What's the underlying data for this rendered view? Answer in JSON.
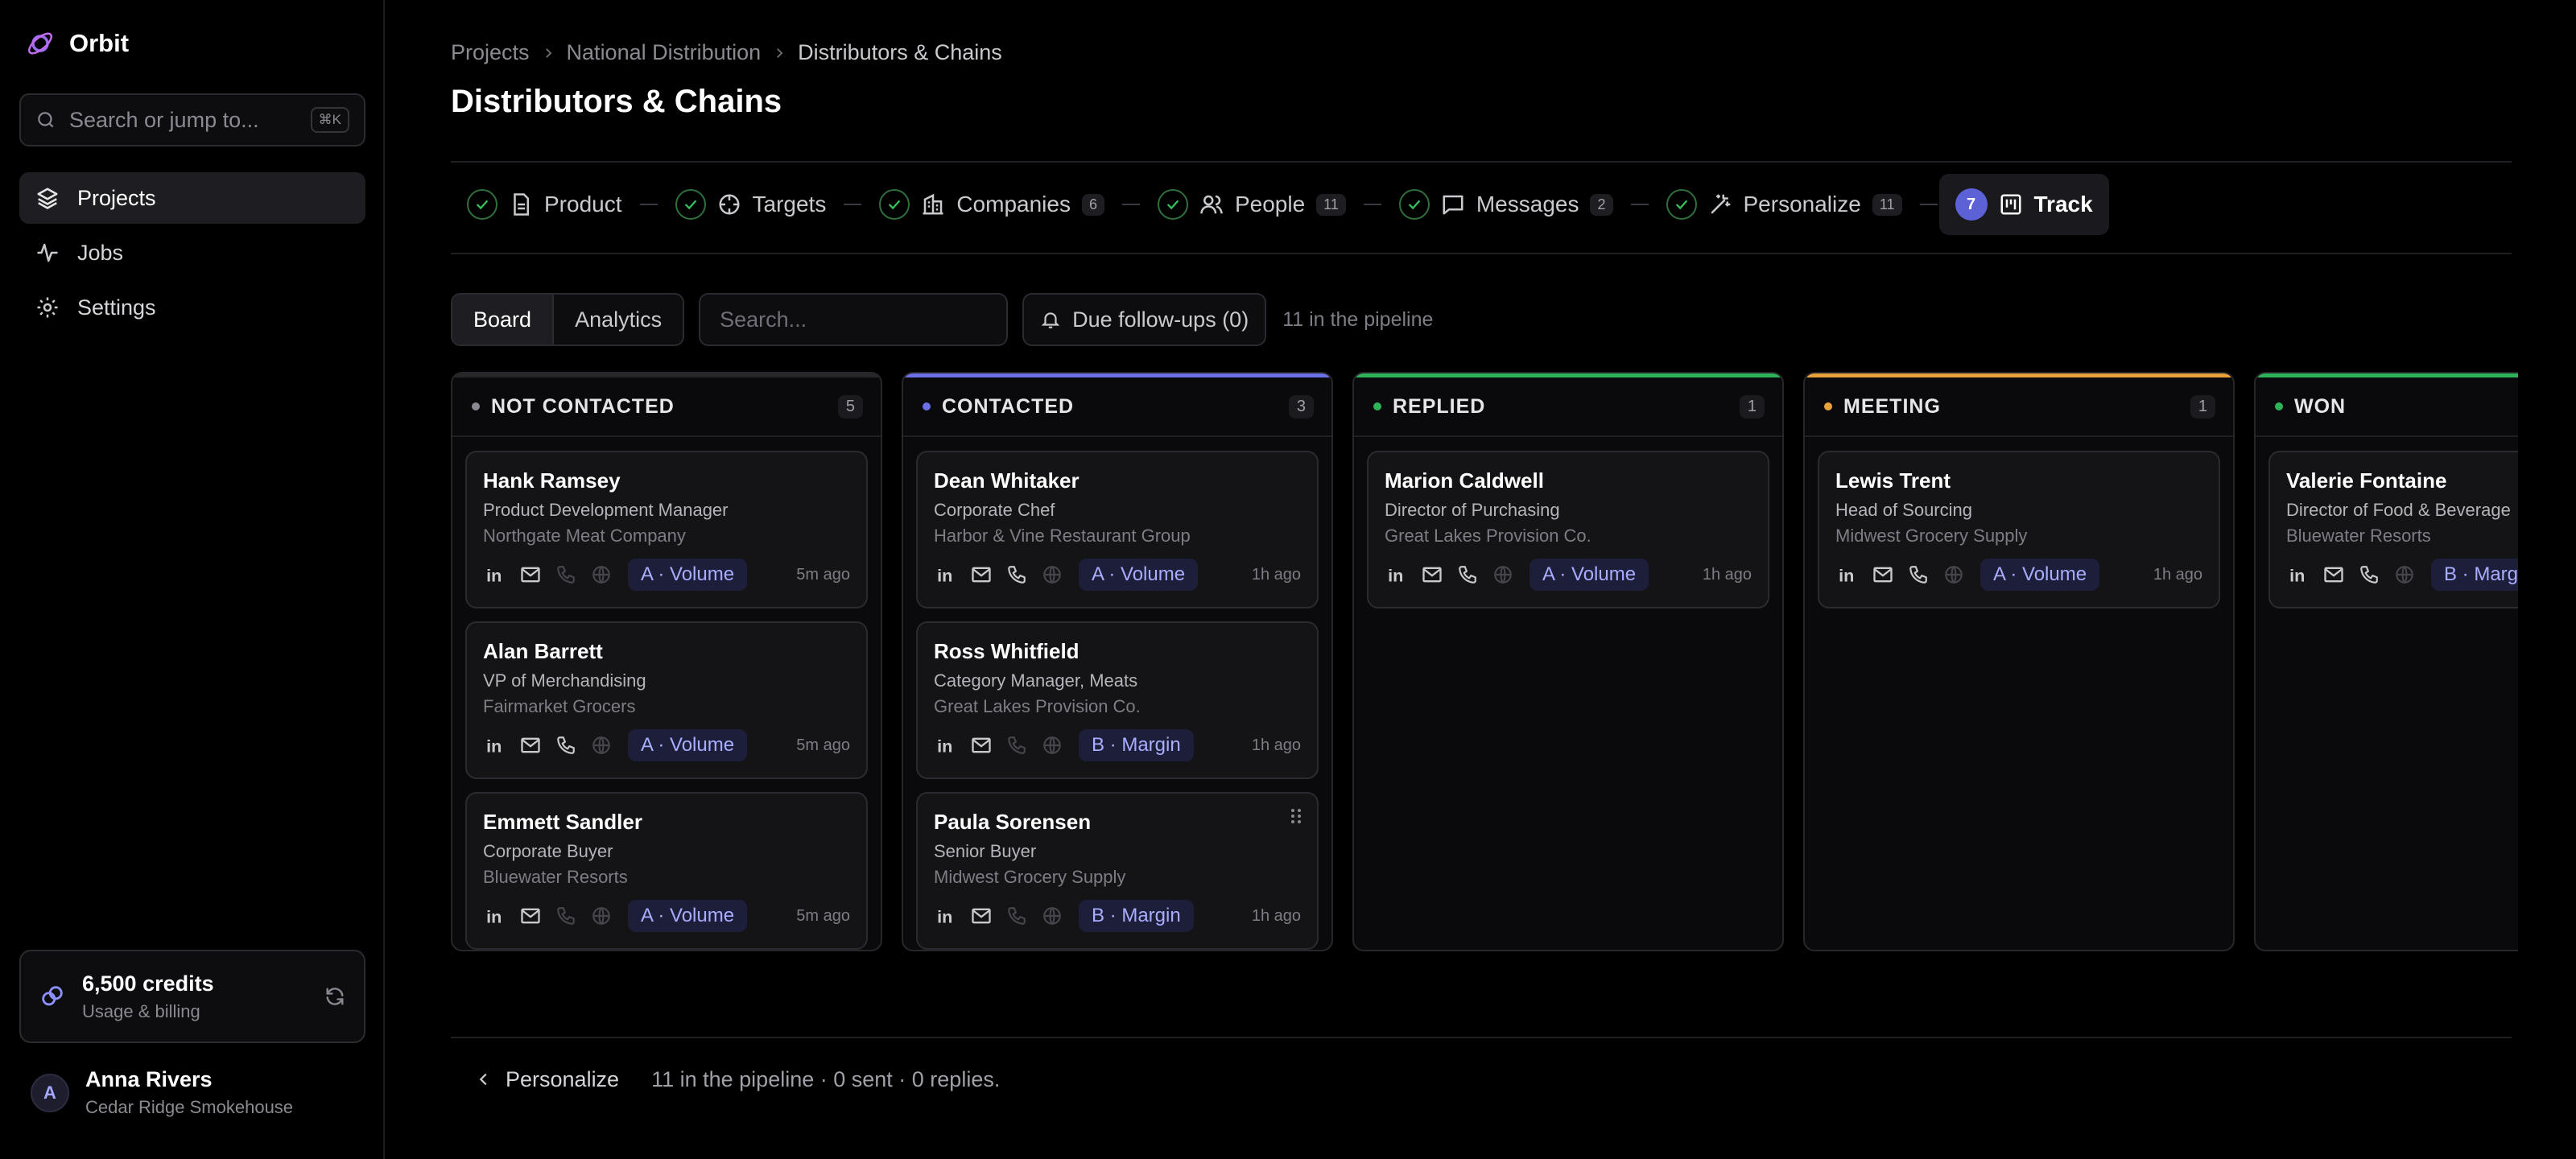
{
  "app": {
    "name": "Orbit",
    "logo_icon": "orbit-logo-icon"
  },
  "search": {
    "placeholder": "Search or jump to...",
    "shortcut": "⌘K"
  },
  "nav": [
    {
      "label": "Projects",
      "icon": "layers-icon",
      "active": true
    },
    {
      "label": "Jobs",
      "icon": "activity-icon",
      "active": false
    },
    {
      "label": "Settings",
      "icon": "gear-icon",
      "active": false
    }
  ],
  "credits": {
    "amount": "6,500 credits",
    "subtitle": "Usage & billing"
  },
  "user": {
    "initial": "A",
    "name": "Anna Rivers",
    "org": "Cedar Ridge Smokehouse"
  },
  "breadcrumb": [
    "Projects",
    "National Distribution",
    "Distributors & Chains"
  ],
  "page_title": "Distributors & Chains",
  "steps": [
    {
      "label": "Product",
      "icon": "file-icon",
      "count": "",
      "done": true
    },
    {
      "label": "Targets",
      "icon": "target-icon",
      "count": "",
      "done": true
    },
    {
      "label": "Companies",
      "icon": "building-icon",
      "count": "6",
      "done": true
    },
    {
      "label": "People",
      "icon": "users-icon",
      "count": "11",
      "done": true
    },
    {
      "label": "Messages",
      "icon": "message-icon",
      "count": "2",
      "done": true
    },
    {
      "label": "Personalize",
      "icon": "wand-icon",
      "count": "11",
      "done": true
    },
    {
      "label": "Track",
      "icon": "kanban-icon",
      "number": "7",
      "active": true
    }
  ],
  "toolbar": {
    "view_tabs": [
      "Board",
      "Analytics"
    ],
    "search_placeholder": "Search...",
    "due_label": "Due follow-ups (0)",
    "pipeline_note": "11 in the pipeline"
  },
  "colors": {
    "accent": "#5c61d6",
    "not_contacted": "#8a8a92",
    "contacted": "#6b70e6",
    "replied": "#2fb35a",
    "meeting": "#e8a23a",
    "won": "#2fb35a"
  },
  "columns": [
    {
      "name": "NOT CONTACTED",
      "count": "5",
      "color": "#8a8a92",
      "bar": "#26262b",
      "cards": [
        {
          "name": "Hank Ramsey",
          "role": "Product Development Manager",
          "org": "Northgate Meat Company",
          "tag": "A · Volume",
          "time": "5m ago",
          "phone": false
        },
        {
          "name": "Alan Barrett",
          "role": "VP of Merchandising",
          "org": "Fairmarket Grocers",
          "tag": "A · Volume",
          "time": "5m ago",
          "phone": true
        },
        {
          "name": "Emmett Sandler",
          "role": "Corporate Buyer",
          "org": "Bluewater Resorts",
          "tag": "A · Volume",
          "time": "5m ago",
          "phone": false
        }
      ]
    },
    {
      "name": "CONTACTED",
      "count": "3",
      "color": "#6b70e6",
      "bar": "#6b70e6",
      "cards": [
        {
          "name": "Dean Whitaker",
          "role": "Corporate Chef",
          "org": "Harbor & Vine Restaurant Group",
          "tag": "A · Volume",
          "time": "1h ago",
          "phone": true
        },
        {
          "name": "Ross Whitfield",
          "role": "Category Manager, Meats",
          "org": "Great Lakes Provision Co.",
          "tag": "B · Margin",
          "time": "1h ago",
          "phone": false
        },
        {
          "name": "Paula Sorensen",
          "role": "Senior Buyer",
          "org": "Midwest Grocery Supply",
          "tag": "B · Margin",
          "time": "1h ago",
          "phone": false,
          "drag": true
        }
      ]
    },
    {
      "name": "REPLIED",
      "count": "1",
      "color": "#2fb35a",
      "bar": "#2fb35a",
      "cards": [
        {
          "name": "Marion Caldwell",
          "role": "Director of Purchasing",
          "org": "Great Lakes Provision Co.",
          "tag": "A · Volume",
          "time": "1h ago",
          "phone": true
        }
      ]
    },
    {
      "name": "MEETING",
      "count": "1",
      "color": "#e8a23a",
      "bar": "#e8a23a",
      "cards": [
        {
          "name": "Lewis Trent",
          "role": "Head of Sourcing",
          "org": "Midwest Grocery Supply",
          "tag": "A · Volume",
          "time": "1h ago",
          "phone": true
        }
      ]
    },
    {
      "name": "WON",
      "count": "",
      "color": "#2fb35a",
      "bar": "#2fb35a",
      "cards": [
        {
          "name": "Valerie Fontaine",
          "role": "Director of Food & Beverage",
          "org": "Bluewater Resorts",
          "tag": "B · Margin",
          "time": "",
          "phone": true
        }
      ]
    }
  ],
  "footer": {
    "back_label": "Personalize",
    "note": "11 in the pipeline · 0 sent · 0 replies."
  }
}
